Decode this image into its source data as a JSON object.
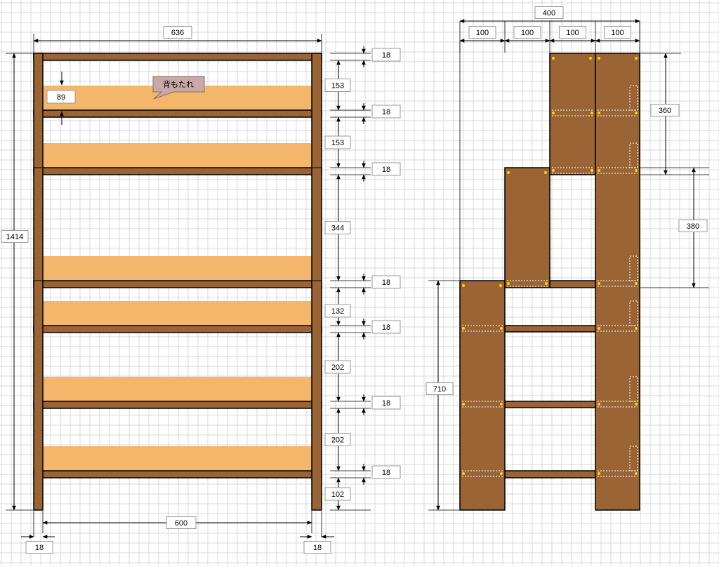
{
  "colors": {
    "wood_dark": "#9a6434",
    "wood_light": "#f4b66a",
    "outline": "#000000",
    "callout_fill": "#c9a9a6",
    "callout_stroke": "#8a6a66",
    "grid": "#d9d9d9",
    "screw": "#ffd400"
  },
  "callout": {
    "label": "背もたれ"
  },
  "front_view": {
    "overall_width": "636",
    "overall_height": "1414",
    "inner_width": "600",
    "post_left": "18",
    "post_right": "18",
    "backrest_gap": "89",
    "board_thickness": [
      "18",
      "18",
      "18",
      "18",
      "18",
      "18",
      "18"
    ],
    "spacings": [
      "153",
      "153",
      "344",
      "132",
      "202",
      "202",
      "102"
    ]
  },
  "side_view": {
    "overall_depth": "400",
    "sections": [
      "100",
      "100",
      "100",
      "100"
    ],
    "height_top": "360",
    "height_mid": "380",
    "height_bottom": "710"
  }
}
